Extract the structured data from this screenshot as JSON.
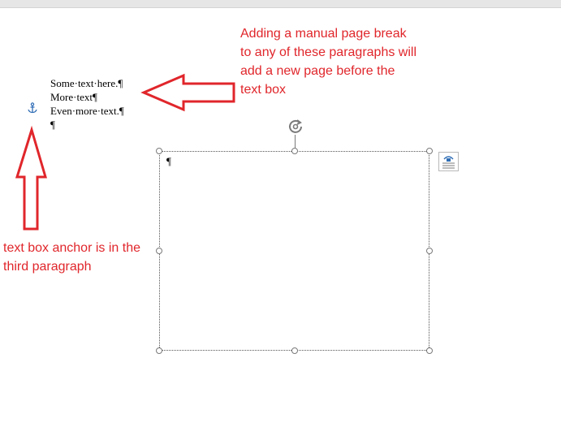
{
  "document": {
    "paragraphs": [
      "Some·text·here.¶",
      "More·text¶",
      "Even·more·text.¶",
      "¶"
    ],
    "textbox_mark": "¶"
  },
  "annotations": {
    "top": "Adding a manual page break to any of these paragraphs will add a new page before the text box",
    "left": "text box anchor is in the third paragraph"
  },
  "icons": {
    "anchor": "anchor-icon",
    "rotate": "rotate-handle-icon",
    "layout_options": "layout-options-icon"
  },
  "colors": {
    "annotation": "#e0262b",
    "anchor": "#2f6db5",
    "handle_border": "#7a7a7a"
  }
}
